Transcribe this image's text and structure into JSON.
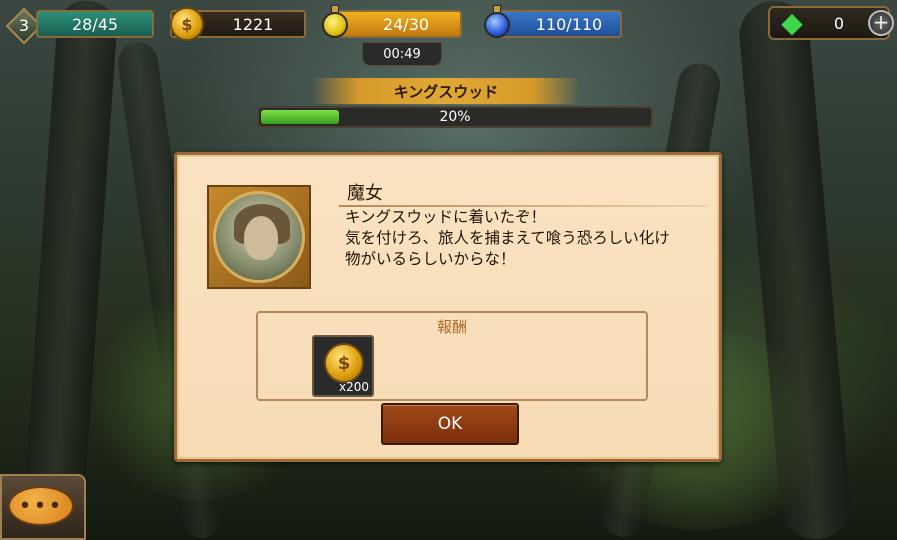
{
  "hud": {
    "level": "3",
    "xp": "28/45",
    "gold": "1221",
    "stamina": "24/30",
    "stamina_timer": "00:49",
    "mana": "110/110",
    "gems": "0",
    "plus": "+"
  },
  "location": {
    "name": "キングスウッド",
    "progress_label": "20%",
    "progress": 0.2
  },
  "dialog": {
    "speaker": "魔女",
    "lines": [
      "キングスウッドに着いたぞ！",
      "気を付けろ、旅人を捕まえて喰う恐ろしい化け",
      "物がいるらしいからな！"
    ],
    "reward_title": "報酬",
    "reward_quantity": "x200",
    "ok_label": "OK"
  },
  "icons": {
    "coin": "gold-coin-icon",
    "stamina": "yellow-potion-icon",
    "mana": "blue-potion-icon",
    "gem": "green-gem-icon",
    "chat": "chat-bubble-icon"
  },
  "colors": {
    "xp_bar": "#2a8f78",
    "stamina_bar": "#e0a020",
    "mana_bar": "#2f66b8",
    "progress_fill": "#5cc834",
    "ok_button": "#8a3a12",
    "dialog_bg": "#f8dfbb"
  }
}
